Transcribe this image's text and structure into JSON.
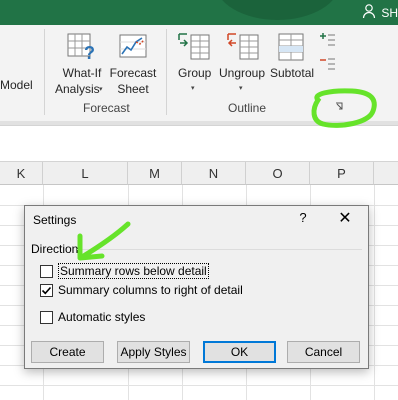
{
  "titlebar": {
    "user_initials": "SH",
    "user_icon": "person-icon"
  },
  "ribbon": {
    "model_label": "Model",
    "forecast": {
      "whatif_line1": "What-If",
      "whatif_line2": "Analysis",
      "forecast_sheet_line1": "Forecast",
      "forecast_sheet_line2": "Sheet",
      "group_label": "Forecast"
    },
    "outline": {
      "group_btn": "Group",
      "ungroup_btn": "Ungroup",
      "subtotal_btn": "Subtotal",
      "group_label": "Outline",
      "launcher_icon": "dialog-launcher-icon"
    }
  },
  "grid": {
    "columns": [
      "K",
      "L",
      "M",
      "N",
      "O",
      "P"
    ]
  },
  "dialog": {
    "title": "Settings",
    "help_glyph": "?",
    "close_glyph": "✕",
    "section_label": "Direction",
    "options": [
      {
        "label": "Summary rows below detail",
        "checked": false
      },
      {
        "label": "Summary columns to right of detail",
        "checked": true
      },
      {
        "label": "Automatic styles",
        "checked": false
      }
    ],
    "buttons": {
      "create": "Create",
      "apply_styles": "Apply Styles",
      "ok": "OK",
      "cancel": "Cancel"
    }
  },
  "annotations": {
    "highlight_color": "#66e32a",
    "excel_green": "#217346"
  }
}
